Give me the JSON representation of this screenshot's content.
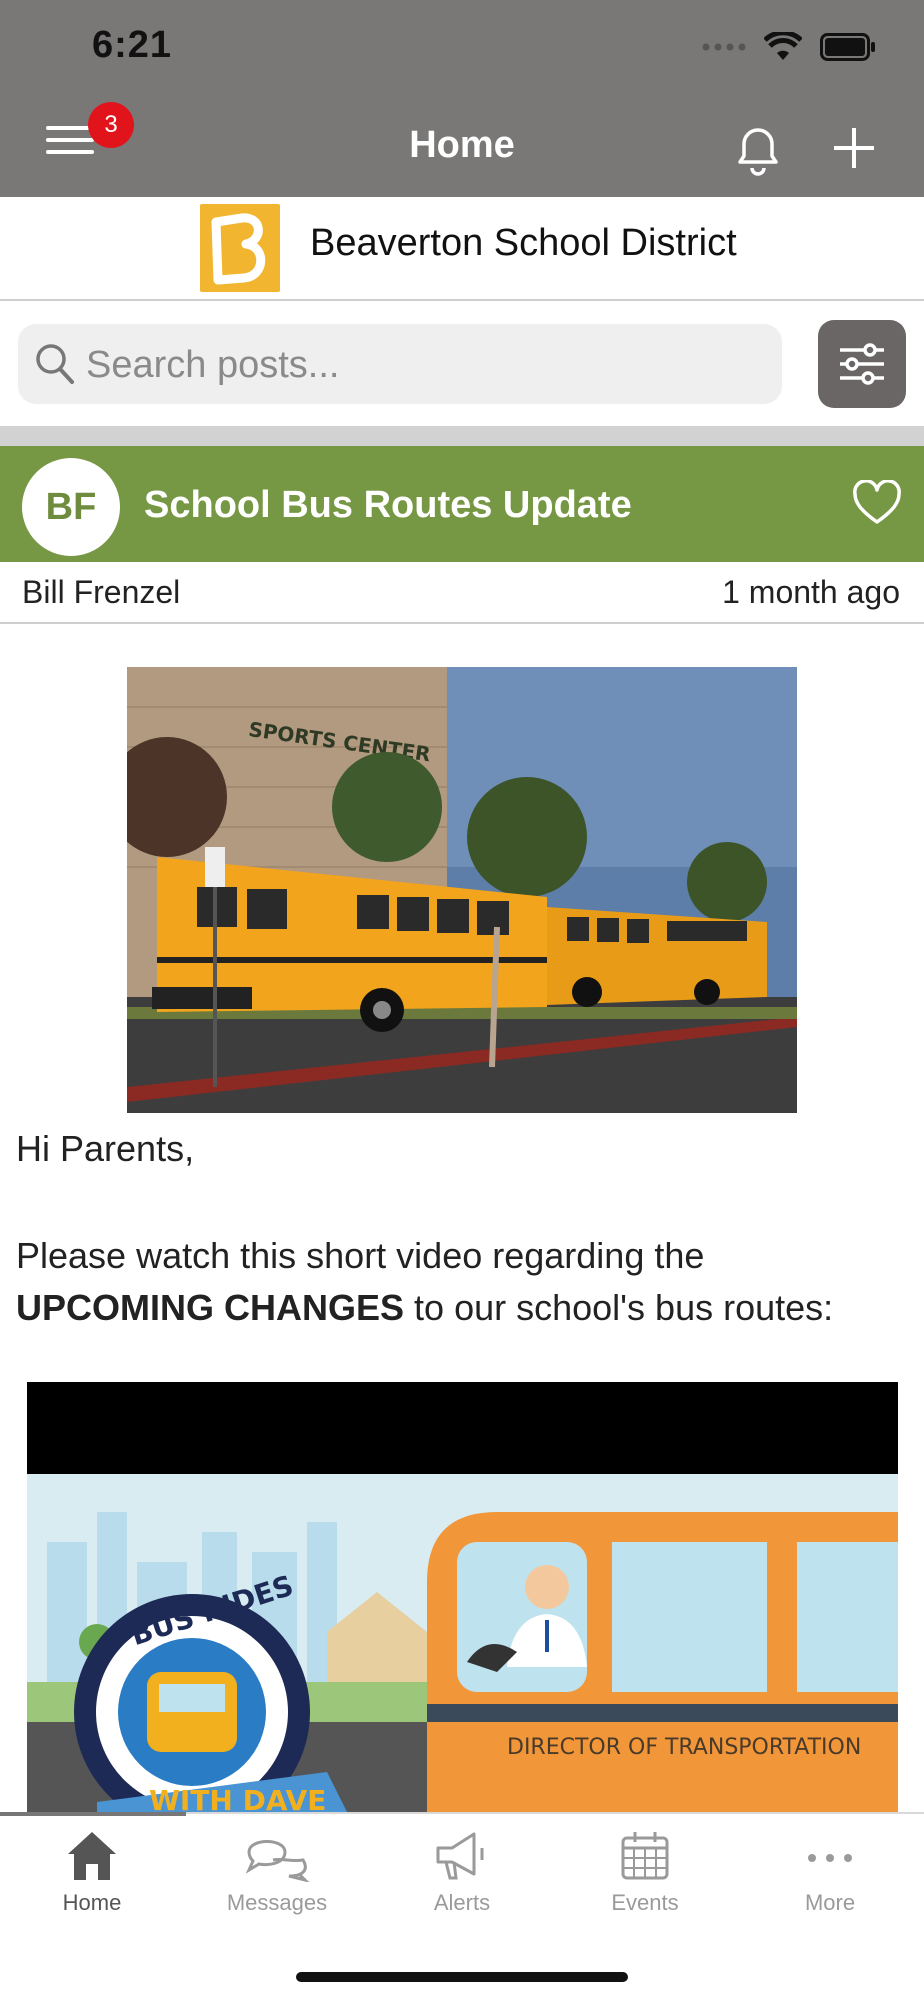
{
  "status_bar": {
    "time": "6:21"
  },
  "header": {
    "title": "Home",
    "menu_badge": "3"
  },
  "district": {
    "name": "Beaverton School District"
  },
  "search": {
    "placeholder": "Search posts..."
  },
  "post": {
    "avatar_initials": "BF",
    "title": "School Bus Routes Update",
    "author": "Bill Frenzel",
    "time": "1 month ago",
    "greeting": "Hi Parents,",
    "body_before": "Please watch this short video regarding the",
    "body_bold": "UPCOMING CHANGES",
    "body_after": "to our school's bus routes:",
    "photo_text": "SPORTS CENTER",
    "video_badge_top": "BUS RIDES",
    "video_badge_bottom": "WITH DAVE",
    "video_bus_text": "DIRECTOR OF TRANSPORTATION"
  },
  "tabs": [
    {
      "label": "Home",
      "icon": "home-icon"
    },
    {
      "label": "Messages",
      "icon": "messages-icon"
    },
    {
      "label": "Alerts",
      "icon": "megaphone-icon"
    },
    {
      "label": "Events",
      "icon": "calendar-icon"
    },
    {
      "label": "More",
      "icon": "more-icon"
    }
  ],
  "colors": {
    "header_bg": "#7a7777",
    "post_header_bg": "#769744",
    "badge": "#e1141c",
    "district_logo": "#f1b52f",
    "tab_active": "#555555",
    "tab_inactive": "#9a9a9a"
  }
}
